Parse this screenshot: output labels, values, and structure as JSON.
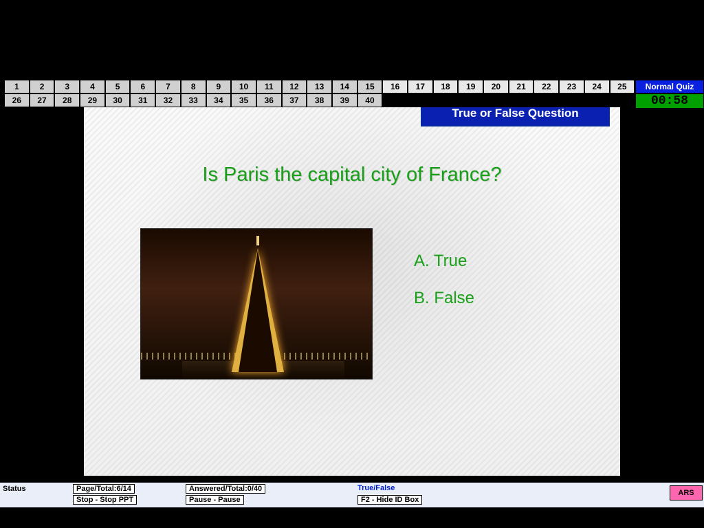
{
  "mode_label": "Normal Quiz",
  "timer": "00:58",
  "question_numbers_row1": [
    "1",
    "2",
    "3",
    "4",
    "5",
    "6",
    "7",
    "8",
    "9",
    "10",
    "11",
    "12",
    "13",
    "14",
    "15",
    "16",
    "17",
    "18",
    "19",
    "20",
    "21",
    "22",
    "23",
    "24",
    "25"
  ],
  "question_numbers_row2": [
    "26",
    "27",
    "28",
    "29",
    "30",
    "31",
    "32",
    "33",
    "34",
    "35",
    "36",
    "37",
    "38",
    "39",
    "40"
  ],
  "highlight_from": 16,
  "qtype_banner": "True or False Question",
  "question_text": "Is Paris the capital city of France?",
  "answers": {
    "a": "A. True",
    "b": "B. False"
  },
  "status": {
    "label": "Status",
    "page_total": "Page/Total:6/14",
    "stop": "Stop - Stop PPT",
    "answered_total": "Answered/Total:0/40",
    "pause": "Pause - Pause",
    "qtype": "True/False",
    "hide_id": "F2 - Hide ID Box",
    "ars": "ARS"
  }
}
